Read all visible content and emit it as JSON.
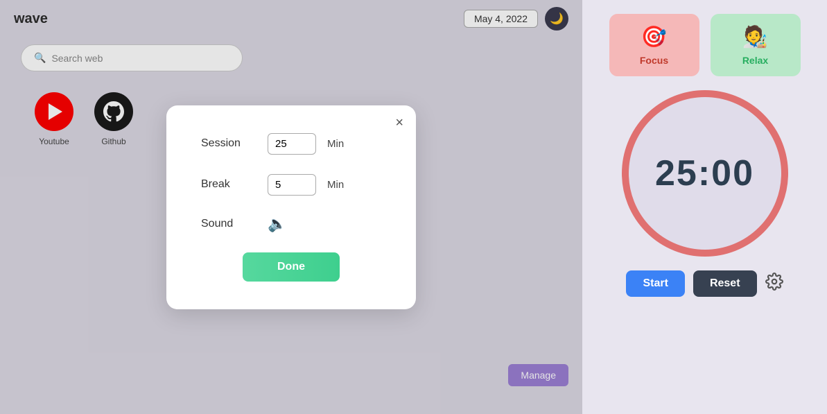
{
  "app": {
    "title": "wave"
  },
  "header": {
    "date": "May 4, 2022",
    "theme_icon": "🌙"
  },
  "search": {
    "placeholder": "Search web"
  },
  "bookmarks": [
    {
      "id": "youtube",
      "label": "Youtube",
      "type": "youtube"
    },
    {
      "id": "github",
      "label": "Github",
      "type": "github"
    }
  ],
  "manage_button": "Manage",
  "modal": {
    "close_label": "×",
    "session_label": "Session",
    "session_value": "25",
    "break_label": "Break",
    "break_value": "5",
    "sound_label": "Sound",
    "min_label": "Min",
    "done_label": "Done"
  },
  "timer": {
    "display": "25:00",
    "focus_label": "Focus",
    "relax_label": "Relax",
    "focus_emoji": "🎯",
    "relax_emoji": "🧑‍🎨",
    "start_label": "Start",
    "reset_label": "Reset"
  }
}
